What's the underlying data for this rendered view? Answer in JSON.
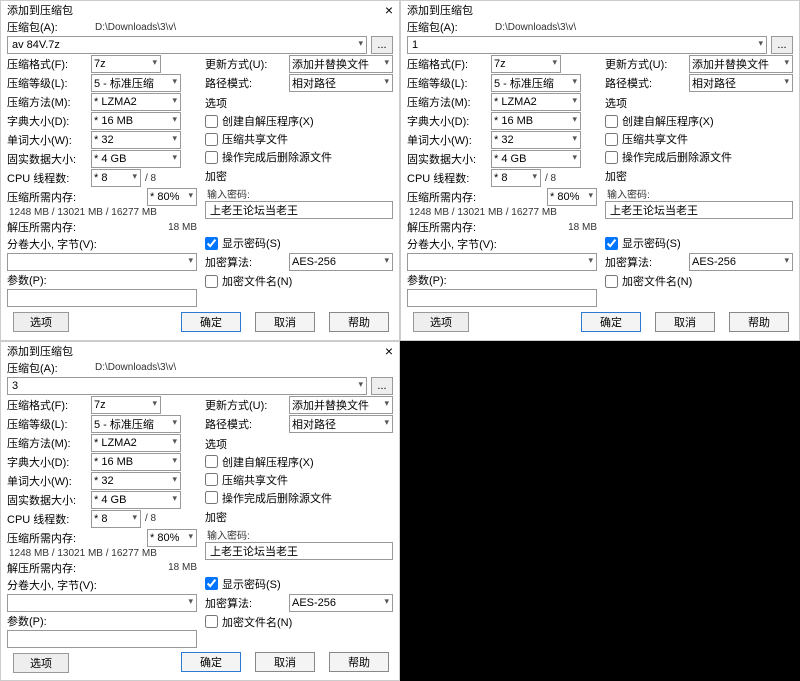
{
  "title": "添加到压缩包",
  "close_glyph": "×",
  "archive_label": "压缩包(A):",
  "path": "D:\\Downloads\\3\\v\\",
  "filenames": [
    "av 84V.7z",
    "1",
    "3"
  ],
  "browse": "...",
  "left": {
    "format_label": "压缩格式(F):",
    "format": "7z",
    "level_label": "压缩等级(L):",
    "level": "5 - 标准压缩",
    "method_label": "压缩方法(M):",
    "method": "* LZMA2",
    "dict_label": "字典大小(D):",
    "dict": "* 16 MB",
    "word_label": "单词大小(W):",
    "word": "* 32",
    "solid_label": "固实数据大小:",
    "solid": "* 4 GB",
    "threads_label": "CPU 线程数:",
    "threads": "* 8",
    "threads_max": "/ 8",
    "mem_c_label": "压缩所需内存:",
    "mem_c": "1248 MB / 13021 MB / 16277 MB",
    "mem_c_pct": "* 80%",
    "mem_d_label": "解压所需内存:",
    "mem_d": "18 MB",
    "split_label": "分卷大小, 字节(V):",
    "params_label": "参数(P):"
  },
  "right": {
    "update_label": "更新方式(U):",
    "update": "添加并替换文件",
    "pathmode_label": "路径模式:",
    "pathmode": "相对路径",
    "options_label": "选项",
    "sfx": "创建自解压程序(X)",
    "shared": "压缩共享文件",
    "del_after": "操作完成后删除源文件",
    "enc_label": "加密",
    "pwd_label": "输入密码:",
    "pwd": "上老王论坛当老王",
    "show_pwd": "显示密码(S)",
    "enc_method_label": "加密算法:",
    "enc_method": "AES-256",
    "enc_names": "加密文件名(N)"
  },
  "options_btn": "选项",
  "ok": "确定",
  "cancel": "取消",
  "help": "帮助"
}
